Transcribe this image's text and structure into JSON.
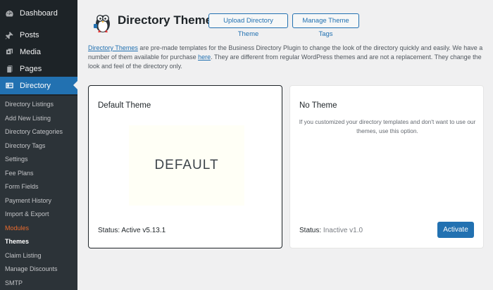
{
  "sidebar": {
    "dashboard": "Dashboard",
    "posts": "Posts",
    "media": "Media",
    "pages": "Pages",
    "directory": "Directory",
    "submenu": [
      "Directory Listings",
      "Add New Listing",
      "Directory Categories",
      "Directory Tags",
      "Settings",
      "Fee Plans",
      "Form Fields",
      "Payment History",
      "Import & Export",
      "Modules",
      "Themes",
      "Claim Listing",
      "Manage Discounts",
      "SMTP"
    ]
  },
  "header": {
    "title": "Directory Themes",
    "upload_label": "Upload Directory Theme",
    "manage_label": "Manage Theme Tags"
  },
  "description": {
    "link_text": "Directory Themes",
    "part1": " are pre-made templates for the Business Directory Plugin to change the look of the directory quickly and easily. We have a number of them available for purchase ",
    "here_link": "here",
    "part2": ". They are different from regular WordPress themes and are not a replacement. They change the look and feel of the directory only."
  },
  "themes": {
    "default": {
      "title": "Default Theme",
      "preview_text": "DEFAULT",
      "status_label": "Status: Active v5.13.1"
    },
    "none": {
      "title": "No Theme",
      "description": "If you customized your directory templates and don't want to use our themes, use this option.",
      "status_prefix": "Status:",
      "status_value": " Inactive v1.0",
      "activate_label": "Activate"
    }
  },
  "colors": {
    "accent": "#2271b1",
    "sidebar_bg": "#1d2327",
    "modules_orange": "#ea6b2e"
  }
}
